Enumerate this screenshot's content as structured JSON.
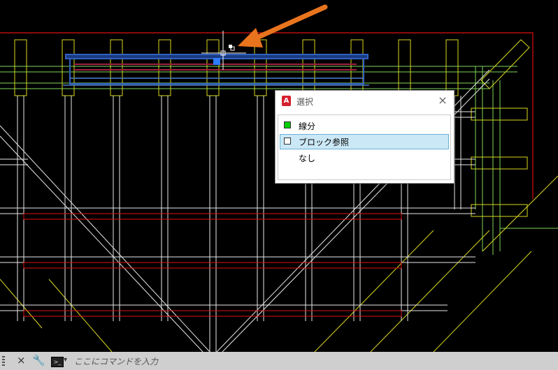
{
  "selection_popup": {
    "title": "選択",
    "close": "×",
    "items": [
      {
        "label": "線分",
        "swatch": "#00cc00",
        "selected": false
      },
      {
        "label": "ブロック参照",
        "swatch": "#ffffff",
        "selected": true
      },
      {
        "label": "なし",
        "swatch": null,
        "selected": false
      }
    ]
  },
  "command_line": {
    "placeholder": "ここにコマンドを入力",
    "close_icon": "×",
    "wrench_icon": "🔧",
    "prompt_icon": ">_",
    "dropdown_icon": "▾"
  },
  "app_icon_letter": "A",
  "colors": {
    "background": "#000000",
    "accent_arrow": "#e8741e",
    "selection": "#2f5fb5"
  }
}
